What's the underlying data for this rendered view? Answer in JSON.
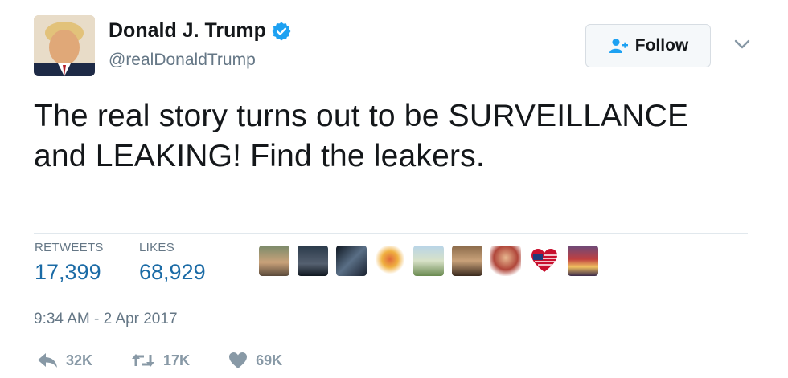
{
  "user": {
    "display_name": "Donald J. Trump",
    "handle": "@realDonaldTrump",
    "verified": true
  },
  "follow_button": {
    "label": "Follow"
  },
  "tweet": {
    "text": "The real story turns out to be SURVEILLANCE and LEAKING! Find the leakers."
  },
  "stats": {
    "retweets_label": "RETWEETS",
    "retweets_value": "17,399",
    "likes_label": "LIKES",
    "likes_value": "68,929"
  },
  "timestamp": "9:34 AM - 2 Apr 2017",
  "actions": {
    "reply_count": "32K",
    "retweet_count": "17K",
    "like_count": "69K"
  },
  "colors": {
    "link_blue": "#1b6ba6",
    "verified_blue": "#1da1f2",
    "muted": "#657786"
  },
  "icons": [
    "verified-badge-icon",
    "follow-person-icon",
    "chevron-down-icon",
    "reply-icon",
    "retweet-icon",
    "heart-icon"
  ]
}
